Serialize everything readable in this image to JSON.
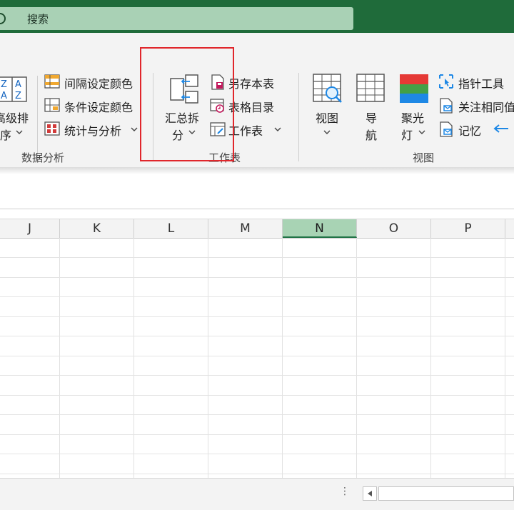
{
  "search": {
    "label": "搜索"
  },
  "ribbon": {
    "sort_button": {
      "line1": "高级排",
      "line2": "序"
    },
    "data_analysis": {
      "items": [
        {
          "label": "间隔设定颜色"
        },
        {
          "label": "条件设定颜色"
        },
        {
          "label": "统计与分析"
        }
      ],
      "group_label": "数据分析"
    },
    "worksheet": {
      "summary_split": {
        "line1": "汇总拆",
        "line2": "分"
      },
      "items": [
        {
          "label": "另存本表"
        },
        {
          "label": "表格目录"
        },
        {
          "label": "工作表"
        }
      ],
      "group_label": "工作表"
    },
    "view": {
      "view_button": {
        "label": "视图"
      },
      "nav_button": {
        "line1": "导",
        "line2": "航"
      },
      "spotlight_button": {
        "line1": "聚光",
        "line2": "灯"
      },
      "items": [
        {
          "label": "指针工具"
        },
        {
          "label": "关注相同值"
        },
        {
          "label": "记忆"
        }
      ],
      "group_label": "视图"
    }
  },
  "sheet": {
    "columns": [
      "J",
      "K",
      "L",
      "M",
      "N",
      "O",
      "P"
    ],
    "selected_column": "N"
  },
  "colors": {
    "title_bar": "#1f6b3a",
    "search_box": "#a9d1b5",
    "selected_column_header": "#a8d3b4",
    "highlight_box": "#e0262b"
  }
}
